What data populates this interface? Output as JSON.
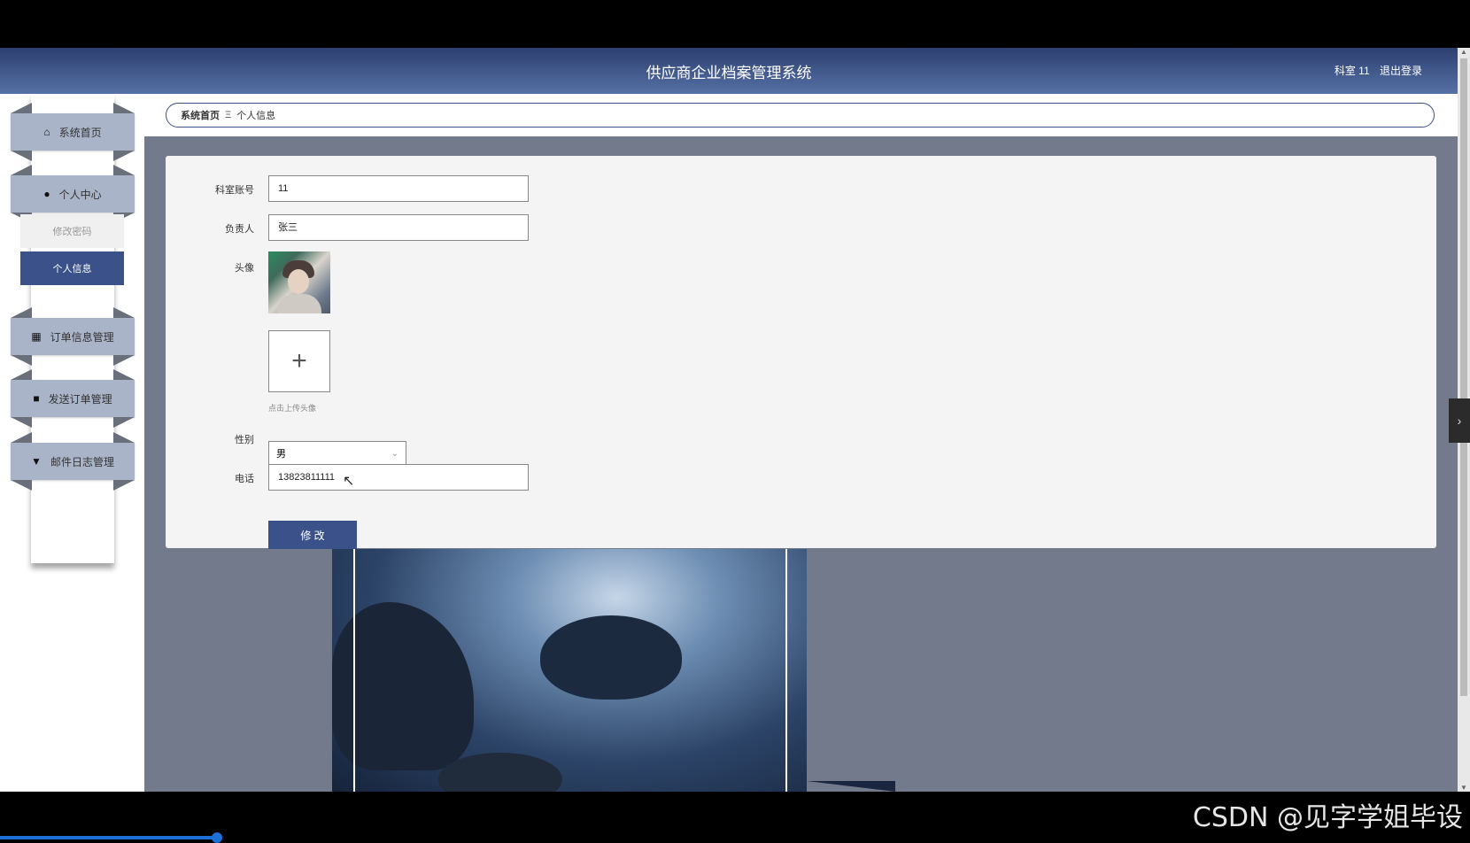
{
  "header": {
    "title": "供应商企业档案管理系统",
    "user_label": "科室 11",
    "logout_label": "退出登录"
  },
  "sidebar": {
    "items": [
      {
        "label": "系统首页",
        "icon": "home-icon"
      },
      {
        "label": "个人中心",
        "icon": "user-icon"
      },
      {
        "label": "订单信息管理",
        "icon": "grid-icon"
      },
      {
        "label": "发送订单管理",
        "icon": "box-icon"
      },
      {
        "label": "邮件日志管理",
        "icon": "trophy-icon"
      }
    ],
    "subitems": [
      {
        "label": "修改密码"
      },
      {
        "label": "个人信息"
      }
    ]
  },
  "breadcrumb": {
    "home": "系统首页",
    "separator": "Ξ",
    "current": "个人信息"
  },
  "form": {
    "account": {
      "label": "科室账号",
      "value": "11"
    },
    "owner": {
      "label": "负责人",
      "value": "张三"
    },
    "avatar": {
      "label": "头像",
      "upload_hint": "点击上传头像"
    },
    "gender": {
      "label": "性别",
      "value": "男"
    },
    "phone": {
      "label": "电话",
      "value": "13823811111"
    },
    "submit_label": "修 改"
  },
  "watermark": "CSDN @见字学姐毕设",
  "colors": {
    "accent": "#3a5189",
    "header_gradient_top": "#2c3f6f",
    "header_gradient_bottom": "#5671a6",
    "ribbon": "#aab4c9",
    "content_bg": "#737a8c"
  }
}
